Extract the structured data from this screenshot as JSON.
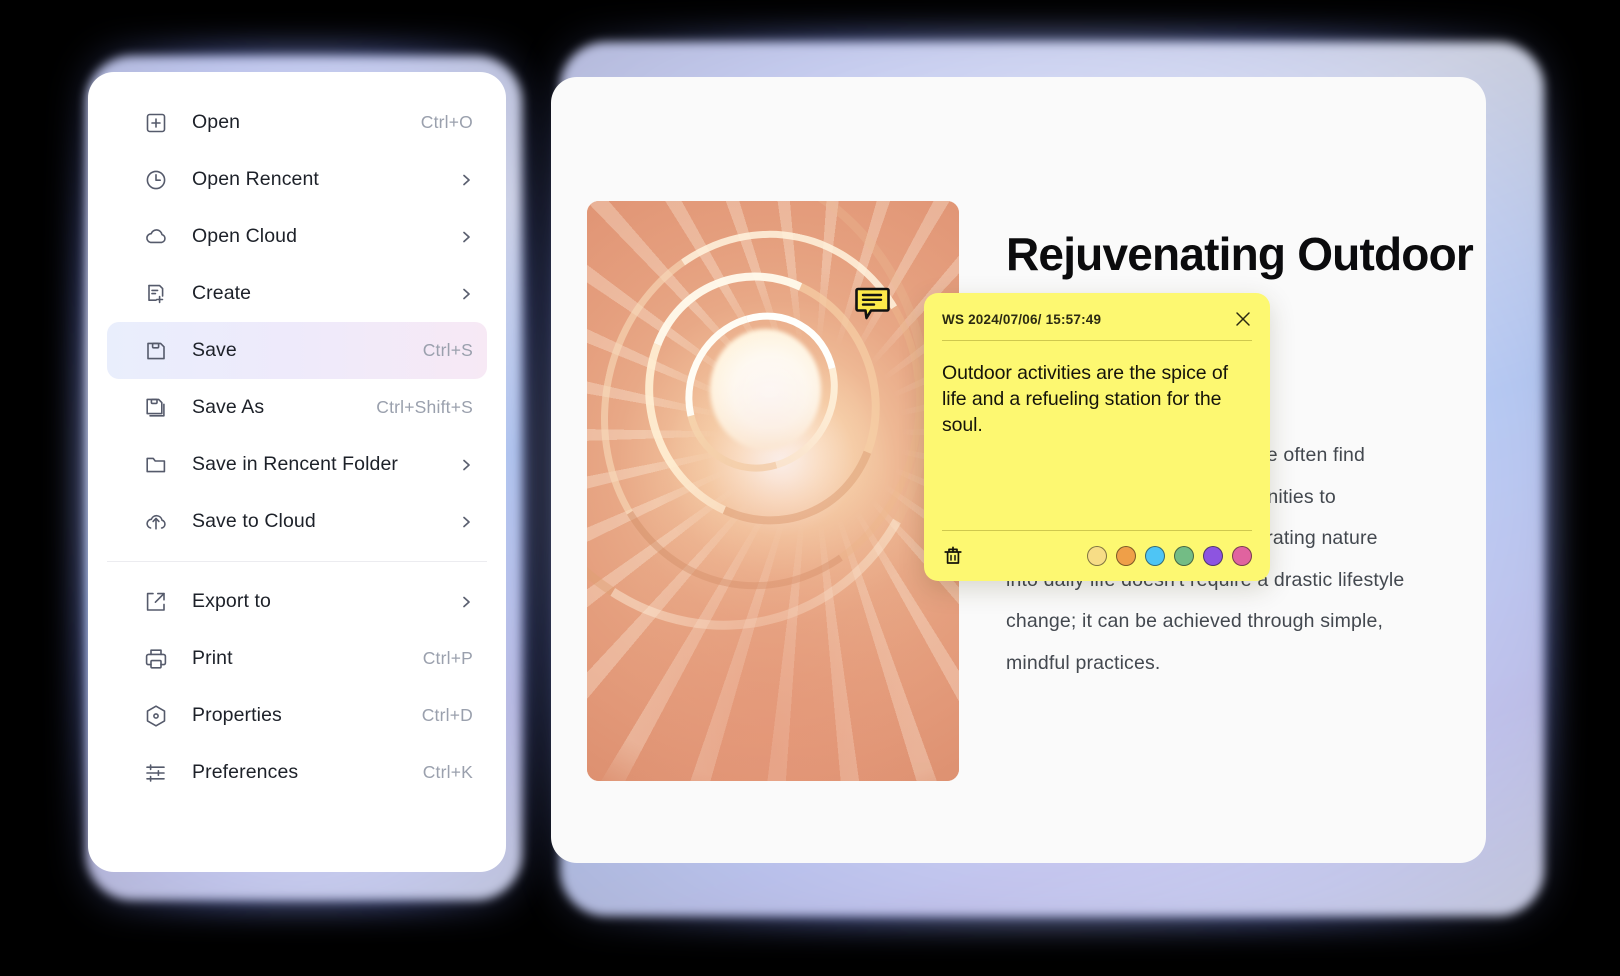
{
  "menu": {
    "groups": [
      {
        "items": [
          {
            "icon": "open-plus-icon",
            "label": "Open",
            "shortcut": "Ctrl+O",
            "submenu": false,
            "selected": false
          },
          {
            "icon": "clock-icon",
            "label": "Open Rencent",
            "shortcut": "",
            "submenu": true,
            "selected": false
          },
          {
            "icon": "cloud-icon",
            "label": "Open Cloud",
            "shortcut": "",
            "submenu": true,
            "selected": false
          },
          {
            "icon": "create-document-icon",
            "label": "Create",
            "shortcut": "",
            "submenu": true,
            "selected": false
          },
          {
            "icon": "floppy-disk-icon",
            "label": "Save",
            "shortcut": "Ctrl+S",
            "submenu": false,
            "selected": true
          },
          {
            "icon": "floppy-disk-copy-icon",
            "label": "Save As",
            "shortcut": "Ctrl+Shift+S",
            "submenu": false,
            "selected": false
          },
          {
            "icon": "folder-icon",
            "label": "Save in Rencent Folder",
            "shortcut": "",
            "submenu": true,
            "selected": false
          },
          {
            "icon": "cloud-upload-icon",
            "label": "Save to Cloud",
            "shortcut": "",
            "submenu": true,
            "selected": false
          }
        ]
      },
      {
        "items": [
          {
            "icon": "export-arrow-icon",
            "label": "Export to",
            "shortcut": "",
            "submenu": true,
            "selected": false
          },
          {
            "icon": "printer-icon",
            "label": "Print",
            "shortcut": "Ctrl+P",
            "submenu": false,
            "selected": false
          },
          {
            "icon": "properties-icon",
            "label": "Properties",
            "shortcut": "Ctrl+D",
            "submenu": false,
            "selected": false
          },
          {
            "icon": "sliders-icon",
            "label": "Preferences",
            "shortcut": "Ctrl+K",
            "submenu": false,
            "selected": false
          }
        ]
      }
    ]
  },
  "document": {
    "photo_alt": "spiral-staircase-photo",
    "title": "Rejuvenating Outdoor Activities",
    "body": "In today's fast-paced world, we often find ourselves with limited opportunities to enhance our well-being. Integrating nature into daily life doesn't require a drastic lifestyle change; it can be achieved through simple, mindful practices."
  },
  "comment_marker": {
    "icon": "comment-bubble-icon"
  },
  "sticky_note": {
    "author": "WS",
    "timestamp": "2024/07/06/ 15:57:49",
    "meta_line": "WS  2024/07/06/ 15:57:49",
    "text": "Outdoor activities are the spice of life and a refueling station for the soul.",
    "close_icon": "close-icon",
    "delete_icon": "trash-icon",
    "background_color": "#fdf871",
    "swatches": [
      {
        "name": "swatch-yellow",
        "color": "#f7dd86"
      },
      {
        "name": "swatch-orange",
        "color": "#ef9f48"
      },
      {
        "name": "swatch-blue",
        "color": "#4ec5f5"
      },
      {
        "name": "swatch-green",
        "color": "#73bc85"
      },
      {
        "name": "swatch-purple",
        "color": "#8d54e0"
      },
      {
        "name": "swatch-pink",
        "color": "#e0639f"
      }
    ]
  },
  "theme": {
    "accent_selected_start": "#e9eefc",
    "accent_selected_end": "#f7e9f5",
    "glow": "#8d9cf5",
    "text_primary": "#1d2129",
    "text_muted": "#9aa0ad"
  }
}
